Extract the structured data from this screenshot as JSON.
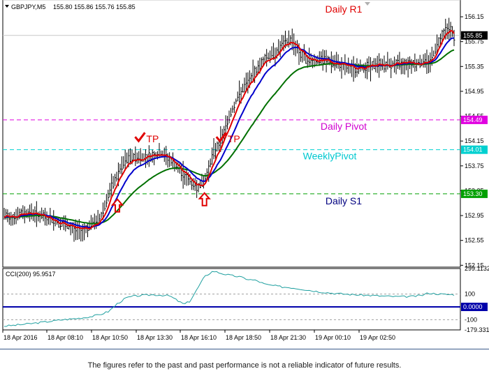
{
  "header": {
    "symbol": "GBPJPY,M5",
    "ohlc": "155.80 155.86 155.76 155.85"
  },
  "colors": {
    "background": "#ffffff",
    "bars": "#000000",
    "ma_fast": "#e00000",
    "ma_mid": "#0000cc",
    "ma_slow": "#007000",
    "pivot": "#e000e0",
    "weekly_pivot": "#00d0d0",
    "s1": "#00a000",
    "r1": "#c0c0c0",
    "cci_line": "#20a0a0",
    "cci_zero": "#0000aa"
  },
  "chart_data": [
    {
      "type": "candlestick-bars",
      "symbol": "GBPJPY",
      "timeframe": "M5",
      "last_price": 155.85,
      "y_ticks": [
        156.15,
        155.75,
        155.35,
        154.95,
        154.55,
        154.15,
        153.75,
        153.35,
        152.95,
        152.55,
        152.15
      ],
      "ylim": [
        152.12,
        156.42
      ],
      "x_ticks": [
        "18 Apr 2016",
        "18 Apr 08:10",
        "18 Apr 10:50",
        "18 Apr 13:30",
        "18 Apr 16:10",
        "18 Apr 18:50",
        "18 Apr 21:30",
        "19 Apr 00:10",
        "19 Apr 02:50"
      ],
      "close_path": [
        [
          0,
          152.95
        ],
        [
          6,
          152.92
        ],
        [
          12,
          152.98
        ],
        [
          18,
          153.0
        ],
        [
          24,
          152.95
        ],
        [
          30,
          152.9
        ],
        [
          36,
          152.86
        ],
        [
          42,
          152.8
        ],
        [
          48,
          152.72
        ],
        [
          54,
          152.7
        ],
        [
          60,
          152.8
        ],
        [
          66,
          152.9
        ],
        [
          72,
          153.3
        ],
        [
          78,
          153.6
        ],
        [
          84,
          153.85
        ],
        [
          90,
          153.9
        ],
        [
          96,
          153.88
        ],
        [
          102,
          153.9
        ],
        [
          108,
          153.95
        ],
        [
          114,
          153.85
        ],
        [
          120,
          153.7
        ],
        [
          126,
          153.55
        ],
        [
          132,
          153.4
        ],
        [
          138,
          153.5
        ],
        [
          144,
          153.95
        ],
        [
          150,
          154.2
        ],
        [
          156,
          154.6
        ],
        [
          162,
          154.9
        ],
        [
          168,
          155.1
        ],
        [
          174,
          155.3
        ],
        [
          180,
          155.5
        ],
        [
          186,
          155.55
        ],
        [
          192,
          155.7
        ],
        [
          198,
          155.8
        ],
        [
          204,
          155.55
        ],
        [
          210,
          155.45
        ],
        [
          216,
          155.45
        ],
        [
          222,
          155.45
        ],
        [
          228,
          155.4
        ],
        [
          234,
          155.35
        ],
        [
          240,
          155.3
        ],
        [
          246,
          155.33
        ],
        [
          252,
          155.35
        ],
        [
          258,
          155.38
        ],
        [
          264,
          155.38
        ],
        [
          270,
          155.38
        ],
        [
          276,
          155.4
        ],
        [
          282,
          155.4
        ],
        [
          288,
          155.42
        ],
        [
          294,
          155.45
        ],
        [
          300,
          155.8
        ],
        [
          306,
          156.0
        ],
        [
          310,
          155.85
        ]
      ],
      "lines": [
        {
          "value": 156.42,
          "label": "Daily R1",
          "color": "#c0c0c0",
          "label_color": "#e00000"
        },
        {
          "value": 154.49,
          "label": "Daily Pivot",
          "color": "#e000e0",
          "label_color": "#d000d0"
        },
        {
          "value": 154.01,
          "label": "WeeklyPivot",
          "color": "#00d0d0",
          "label_color": "#00c8d0"
        },
        {
          "value": 153.3,
          "label": "Daily S1",
          "color": "#00a000",
          "label_color": "#000080"
        }
      ],
      "annotations": [
        {
          "text": "TP",
          "x": 96,
          "price": 154.15,
          "color": "#e00000"
        },
        {
          "text": "TP",
          "x": 152,
          "price": 154.15,
          "color": "#e00000"
        }
      ],
      "signals": [
        {
          "type": "buy-arrow",
          "x": 78,
          "price": 153.1
        },
        {
          "type": "buy-arrow",
          "x": 138,
          "price": 153.2
        }
      ]
    },
    {
      "type": "line",
      "indicator": "CCI(200)",
      "value": 95.9517,
      "y_ticks": [
        299.1132,
        100,
        0.0,
        -100,
        -179.3314
      ],
      "ylim": [
        -179.3314,
        299.1132
      ],
      "cci_path": [
        [
          0,
          -150
        ],
        [
          10,
          -140
        ],
        [
          20,
          -128
        ],
        [
          30,
          -115
        ],
        [
          40,
          -100
        ],
        [
          50,
          -90
        ],
        [
          56,
          -82
        ],
        [
          60,
          -75
        ],
        [
          66,
          -60
        ],
        [
          72,
          -35
        ],
        [
          78,
          25
        ],
        [
          84,
          70
        ],
        [
          90,
          85
        ],
        [
          96,
          90
        ],
        [
          102,
          95
        ],
        [
          108,
          92
        ],
        [
          114,
          86
        ],
        [
          120,
          45
        ],
        [
          124,
          20
        ],
        [
          128,
          45
        ],
        [
          132,
          120
        ],
        [
          138,
          235
        ],
        [
          144,
          280
        ],
        [
          150,
          260
        ],
        [
          156,
          245
        ],
        [
          162,
          235
        ],
        [
          168,
          215
        ],
        [
          174,
          205
        ],
        [
          180,
          175
        ],
        [
          186,
          165
        ],
        [
          192,
          155
        ],
        [
          198,
          150
        ],
        [
          204,
          140
        ],
        [
          210,
          130
        ],
        [
          216,
          120
        ],
        [
          222,
          112
        ],
        [
          228,
          105
        ],
        [
          234,
          100
        ],
        [
          240,
          96
        ],
        [
          246,
          92
        ],
        [
          252,
          90
        ],
        [
          258,
          86
        ],
        [
          264,
          83
        ],
        [
          270,
          80
        ],
        [
          276,
          80
        ],
        [
          282,
          82
        ],
        [
          288,
          90
        ],
        [
          292,
          108
        ],
        [
          296,
          104
        ],
        [
          300,
          100
        ],
        [
          306,
          96
        ],
        [
          310,
          95.95
        ]
      ],
      "zero_line": 0.0
    }
  ],
  "price_labels": {
    "current": "155.85",
    "pivot": "154.49",
    "weekly_pivot": "154.01",
    "s1": "153.30",
    "cci_zero": "0.0000"
  },
  "indicator_title": "CCI(200) 95.9517",
  "disclaimer": "The figures refer to the past and past performance is not a reliable indicator of future results."
}
